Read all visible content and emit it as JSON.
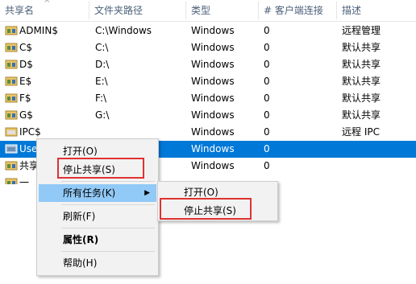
{
  "columns": {
    "name": "共享名",
    "path": "文件夹路径",
    "type": "类型",
    "clients": "# 客户端连接",
    "desc": "描述"
  },
  "rows": [
    {
      "name": "ADMIN$",
      "path": "C:\\Windows",
      "type": "Windows",
      "clients": "0",
      "desc": "远程管理"
    },
    {
      "name": "C$",
      "path": "C:\\",
      "type": "Windows",
      "clients": "0",
      "desc": "默认共享"
    },
    {
      "name": "D$",
      "path": "D:\\",
      "type": "Windows",
      "clients": "0",
      "desc": "默认共享"
    },
    {
      "name": "E$",
      "path": "E:\\",
      "type": "Windows",
      "clients": "0",
      "desc": "默认共享"
    },
    {
      "name": "F$",
      "path": "F:\\",
      "type": "Windows",
      "clients": "0",
      "desc": "默认共享"
    },
    {
      "name": "G$",
      "path": "G:\\",
      "type": "Windows",
      "clients": "0",
      "desc": "默认共享"
    },
    {
      "name": "IPC$",
      "path": "",
      "type": "Windows",
      "clients": "0",
      "desc": "远程 IPC"
    },
    {
      "name": "Use",
      "path": "",
      "type": "Windows",
      "clients": "0",
      "desc": ""
    },
    {
      "name": "共享",
      "path": "",
      "type": "Windows",
      "clients": "0",
      "desc": ""
    },
    {
      "name": "一",
      "path": "",
      "type": "",
      "clients": "",
      "desc": ""
    }
  ],
  "context_menu": {
    "open": "打开(O)",
    "stop_share": "停止共享(S)",
    "all_tasks": "所有任务(K)",
    "refresh": "刷新(F)",
    "properties": "属性(R)",
    "help": "帮助(H)"
  },
  "submenu": {
    "open": "打开(O)",
    "stop_share": "停止共享(S)"
  },
  "colors": {
    "selection": "#0078d7",
    "menu_hover": "#91c9f7",
    "highlight_box": "#e03131"
  }
}
